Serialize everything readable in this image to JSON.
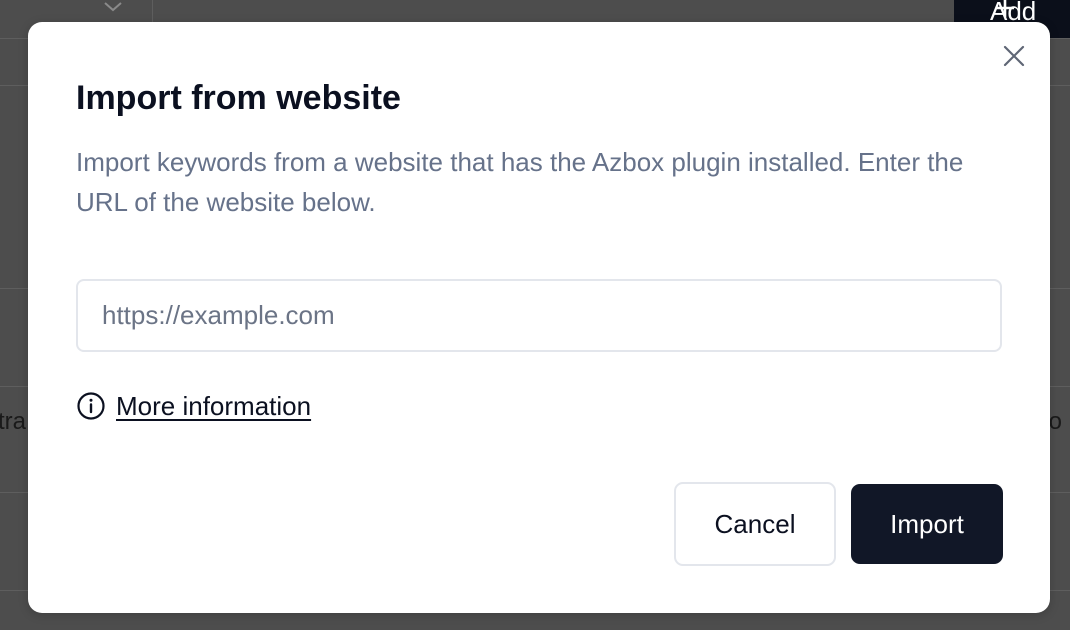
{
  "background": {
    "add_button_label": "Add",
    "left_text": "tra",
    "right_text": "cto"
  },
  "modal": {
    "title": "Import from website",
    "description": "Import keywords from a website that has the Azbox plugin installed. Enter the URL of the website below.",
    "url_input": {
      "value": "",
      "placeholder": "https://example.com"
    },
    "more_info_label": "More information",
    "cancel_label": "Cancel",
    "import_label": "Import"
  },
  "icons": {
    "close": "close-icon",
    "info": "info-icon",
    "chevron": "chevron-down-icon",
    "plus": "plus-icon"
  },
  "colors": {
    "primary_button": "#111727",
    "title_text": "#0b1020",
    "muted_text": "#66728a",
    "border": "#e3e6ec",
    "overlay": "#4d4d4d"
  }
}
